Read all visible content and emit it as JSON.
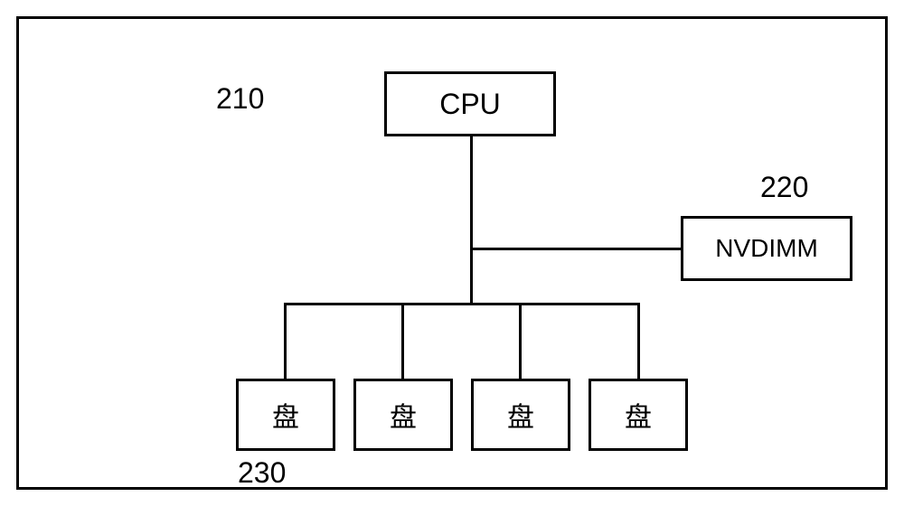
{
  "labels": {
    "l210": "210",
    "l220": "220",
    "l230": "230"
  },
  "blocks": {
    "cpu": "CPU",
    "nvdimm": "NVDIMM",
    "disk1": "盘",
    "disk2": "盘",
    "disk3": "盘",
    "disk4": "盘"
  }
}
